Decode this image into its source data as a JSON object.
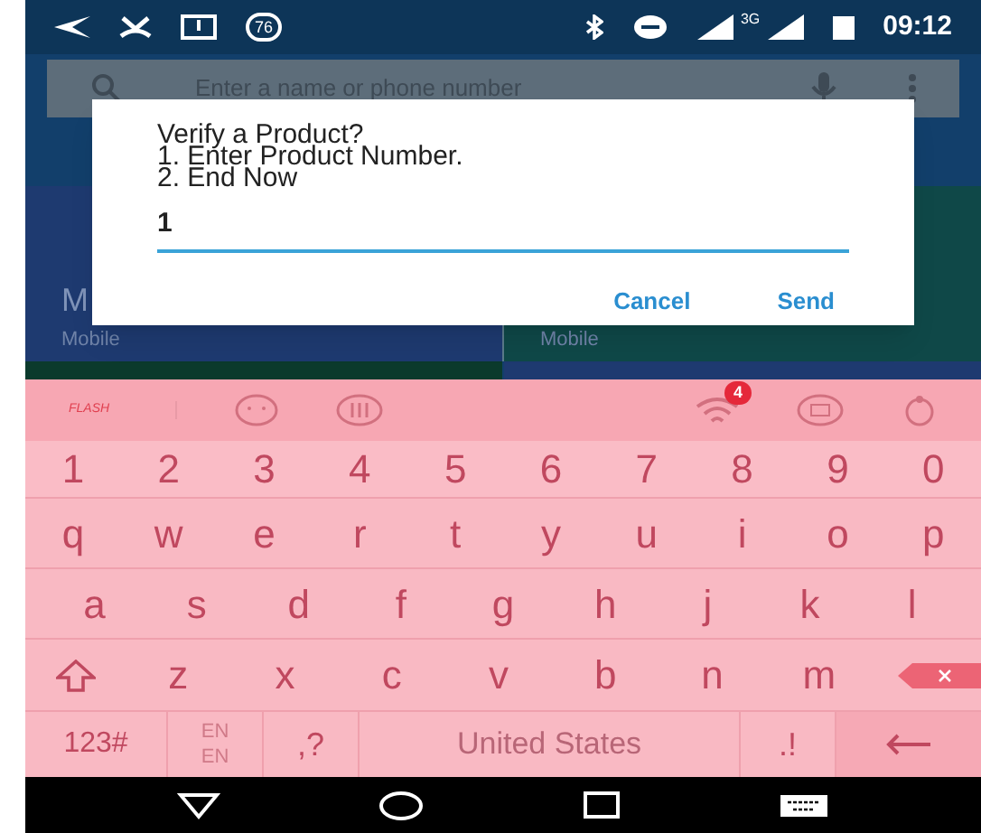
{
  "status_bar": {
    "badge": "76",
    "network": "3G",
    "time": "09:12"
  },
  "search": {
    "placeholder": "Enter a name or phone number"
  },
  "tiles": [
    {
      "title": "M",
      "subtitle": "Mobile"
    },
    {
      "subtitle": "Mobile"
    }
  ],
  "dialog": {
    "lines": [
      "Verify a Product?",
      "1. Enter Product Number.",
      "2. End Now"
    ],
    "input_value": "1",
    "buttons": [
      "Cancel",
      "Send"
    ]
  },
  "keyboard": {
    "logo": "FLASH",
    "notification_count": "4",
    "rows": [
      [
        "1",
        "2",
        "3",
        "4",
        "5",
        "6",
        "7",
        "8",
        "9",
        "0"
      ],
      [
        "q",
        "w",
        "e",
        "r",
        "t",
        "y",
        "u",
        "i",
        "o",
        "p"
      ],
      [
        "a",
        "s",
        "d",
        "f",
        "g",
        "h",
        "j",
        "k",
        "l"
      ],
      [
        "z",
        "x",
        "c",
        "v",
        "b",
        "n",
        "m"
      ]
    ],
    "bottom": {
      "symbols": "123#",
      "lang_top": "EN",
      "lang_bottom": "EN",
      "punct_left": ",?",
      "space": "United States",
      "punct_right": ".!"
    }
  }
}
